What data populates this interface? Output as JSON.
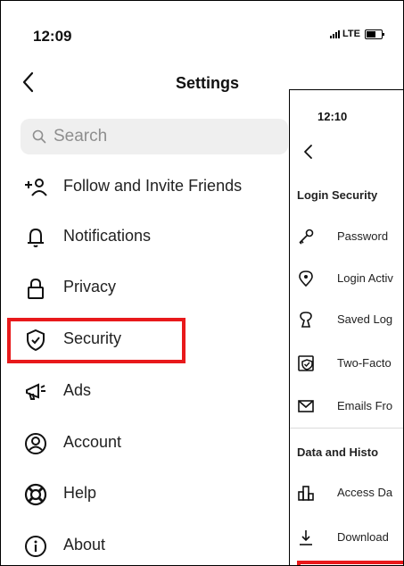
{
  "status": {
    "time": "12:09",
    "network": "LTE"
  },
  "header": {
    "title": "Settings"
  },
  "search": {
    "placeholder": "Search"
  },
  "menu": [
    {
      "label": "Follow and Invite Friends",
      "icon": "add-person-icon"
    },
    {
      "label": "Notifications",
      "icon": "bell-icon"
    },
    {
      "label": "Privacy",
      "icon": "lock-icon"
    },
    {
      "label": "Security",
      "icon": "shield-check-icon",
      "highlighted": true
    },
    {
      "label": "Ads",
      "icon": "megaphone-icon"
    },
    {
      "label": "Account",
      "icon": "account-circle-icon"
    },
    {
      "label": "Help",
      "icon": "lifebuoy-icon"
    },
    {
      "label": "About",
      "icon": "info-icon"
    }
  ],
  "overlay": {
    "time": "12:10",
    "login_section": "Login Security",
    "login_items": [
      {
        "label": "Password",
        "icon": "key-icon"
      },
      {
        "label": "Login Activ",
        "icon": "location-pin-icon"
      },
      {
        "label": "Saved Log",
        "icon": "keyhole-icon"
      },
      {
        "label": "Two-Facto",
        "icon": "phone-shield-icon"
      },
      {
        "label": "Emails Fro",
        "icon": "envelope-icon"
      }
    ],
    "data_section": "Data and Histo",
    "data_items": [
      {
        "label": "Access Da",
        "icon": "bar-chart-icon"
      },
      {
        "label": "Download",
        "icon": "download-icon"
      }
    ]
  },
  "colors": {
    "highlight": "#e8191b",
    "search_bg": "#efefef"
  }
}
